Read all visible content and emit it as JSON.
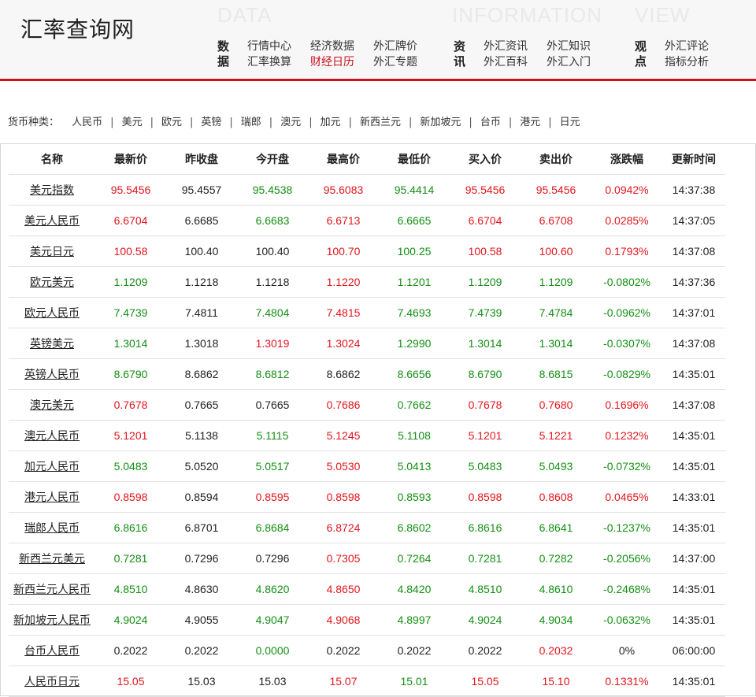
{
  "header": {
    "logo": "汇率查询网",
    "bg_words": [
      "DATA",
      "INFORMATION",
      "VIEW"
    ],
    "groups": [
      {
        "head": [
          "数",
          "据"
        ],
        "links": [
          "行情中心",
          "经济数据",
          "外汇牌价",
          "汇率换算",
          "财经日历",
          "外汇专题"
        ]
      },
      {
        "head": [
          "资",
          "讯"
        ],
        "links": [
          "外汇资讯",
          "外汇知识",
          "外汇百科",
          "外汇入门"
        ]
      },
      {
        "head": [
          "观",
          "点"
        ],
        "links": [
          "外汇评论",
          "指标分析"
        ]
      }
    ],
    "active_link": "财经日历"
  },
  "currency_bar": {
    "label": "货币种类：",
    "items": [
      "人民币",
      "美元",
      "欧元",
      "英镑",
      "瑞郎",
      "澳元",
      "加元",
      "新西兰元",
      "新加坡元",
      "台币",
      "港元",
      "日元"
    ],
    "separator": "|"
  },
  "colors": {
    "up": "#e1161d",
    "down": "#138f13",
    "flat": "#222222",
    "accent": "#c8121e"
  },
  "table": {
    "columns": [
      "名称",
      "最新价",
      "昨收盘",
      "今开盘",
      "最高价",
      "最低价",
      "买入价",
      "卖出价",
      "涨跌幅",
      "更新时间"
    ],
    "rows": [
      {
        "cells": [
          "美元指数",
          "95.5456",
          "95.4557",
          "95.4538",
          "95.6083",
          "95.4414",
          "95.5456",
          "95.5456",
          "0.0942%",
          "14:37:38"
        ],
        "colors": [
          "n",
          "r",
          "k",
          "g",
          "r",
          "g",
          "r",
          "r",
          "r",
          "k"
        ]
      },
      {
        "cells": [
          "美元人民币",
          "6.6704",
          "6.6685",
          "6.6683",
          "6.6713",
          "6.6665",
          "6.6704",
          "6.6708",
          "0.0285%",
          "14:37:05"
        ],
        "colors": [
          "n",
          "r",
          "k",
          "g",
          "r",
          "g",
          "r",
          "r",
          "r",
          "k"
        ]
      },
      {
        "cells": [
          "美元日元",
          "100.58",
          "100.40",
          "100.40",
          "100.70",
          "100.25",
          "100.58",
          "100.60",
          "0.1793%",
          "14:37:08"
        ],
        "colors": [
          "n",
          "r",
          "k",
          "k",
          "r",
          "g",
          "r",
          "r",
          "r",
          "k"
        ]
      },
      {
        "cells": [
          "欧元美元",
          "1.1209",
          "1.1218",
          "1.1218",
          "1.1220",
          "1.1201",
          "1.1209",
          "1.1209",
          "-0.0802%",
          "14:37:36"
        ],
        "colors": [
          "n",
          "g",
          "k",
          "k",
          "r",
          "g",
          "g",
          "g",
          "g",
          "k"
        ]
      },
      {
        "cells": [
          "欧元人民币",
          "7.4739",
          "7.4811",
          "7.4804",
          "7.4815",
          "7.4693",
          "7.4739",
          "7.4784",
          "-0.0962%",
          "14:37:01"
        ],
        "colors": [
          "n",
          "g",
          "k",
          "g",
          "r",
          "g",
          "g",
          "g",
          "g",
          "k"
        ]
      },
      {
        "cells": [
          "英镑美元",
          "1.3014",
          "1.3018",
          "1.3019",
          "1.3024",
          "1.2990",
          "1.3014",
          "1.3014",
          "-0.0307%",
          "14:37:08"
        ],
        "colors": [
          "n",
          "g",
          "k",
          "r",
          "r",
          "g",
          "g",
          "g",
          "g",
          "k"
        ]
      },
      {
        "cells": [
          "英镑人民币",
          "8.6790",
          "8.6862",
          "8.6812",
          "8.6862",
          "8.6656",
          "8.6790",
          "8.6815",
          "-0.0829%",
          "14:35:01"
        ],
        "colors": [
          "n",
          "g",
          "k",
          "g",
          "k",
          "g",
          "g",
          "g",
          "g",
          "k"
        ]
      },
      {
        "cells": [
          "澳元美元",
          "0.7678",
          "0.7665",
          "0.7665",
          "0.7686",
          "0.7662",
          "0.7678",
          "0.7680",
          "0.1696%",
          "14:37:08"
        ],
        "colors": [
          "n",
          "r",
          "k",
          "k",
          "r",
          "g",
          "r",
          "r",
          "r",
          "k"
        ]
      },
      {
        "cells": [
          "澳元人民币",
          "5.1201",
          "5.1138",
          "5.1115",
          "5.1245",
          "5.1108",
          "5.1201",
          "5.1221",
          "0.1232%",
          "14:35:01"
        ],
        "colors": [
          "n",
          "r",
          "k",
          "g",
          "r",
          "g",
          "r",
          "r",
          "r",
          "k"
        ]
      },
      {
        "cells": [
          "加元人民币",
          "5.0483",
          "5.0520",
          "5.0517",
          "5.0530",
          "5.0413",
          "5.0483",
          "5.0493",
          "-0.0732%",
          "14:35:01"
        ],
        "colors": [
          "n",
          "g",
          "k",
          "g",
          "r",
          "g",
          "g",
          "g",
          "g",
          "k"
        ]
      },
      {
        "cells": [
          "港元人民币",
          "0.8598",
          "0.8594",
          "0.8595",
          "0.8598",
          "0.8593",
          "0.8598",
          "0.8608",
          "0.0465%",
          "14:33:01"
        ],
        "colors": [
          "n",
          "r",
          "k",
          "r",
          "r",
          "g",
          "r",
          "r",
          "r",
          "k"
        ]
      },
      {
        "cells": [
          "瑞郎人民币",
          "6.8616",
          "6.8701",
          "6.8684",
          "6.8724",
          "6.8602",
          "6.8616",
          "6.8641",
          "-0.1237%",
          "14:35:01"
        ],
        "colors": [
          "n",
          "g",
          "k",
          "g",
          "r",
          "g",
          "g",
          "g",
          "g",
          "k"
        ]
      },
      {
        "cells": [
          "新西兰元美元",
          "0.7281",
          "0.7296",
          "0.7296",
          "0.7305",
          "0.7264",
          "0.7281",
          "0.7282",
          "-0.2056%",
          "14:37:00"
        ],
        "colors": [
          "n",
          "g",
          "k",
          "k",
          "r",
          "g",
          "g",
          "g",
          "g",
          "k"
        ]
      },
      {
        "cells": [
          "新西兰元人民币",
          "4.8510",
          "4.8630",
          "4.8620",
          "4.8650",
          "4.8420",
          "4.8510",
          "4.8610",
          "-0.2468%",
          "14:35:01"
        ],
        "colors": [
          "n",
          "g",
          "k",
          "g",
          "r",
          "g",
          "g",
          "g",
          "g",
          "k"
        ]
      },
      {
        "cells": [
          "新加坡元人民币",
          "4.9024",
          "4.9055",
          "4.9047",
          "4.9068",
          "4.8997",
          "4.9024",
          "4.9034",
          "-0.0632%",
          "14:35:01"
        ],
        "colors": [
          "n",
          "g",
          "k",
          "g",
          "r",
          "g",
          "g",
          "g",
          "g",
          "k"
        ]
      },
      {
        "cells": [
          "台币人民币",
          "0.2022",
          "0.2022",
          "0.0000",
          "0.2022",
          "0.2022",
          "0.2022",
          "0.2032",
          "0%",
          "06:00:00"
        ],
        "colors": [
          "n",
          "k",
          "k",
          "g",
          "k",
          "k",
          "k",
          "r",
          "k",
          "k"
        ]
      },
      {
        "cells": [
          "人民币日元",
          "15.05",
          "15.03",
          "15.03",
          "15.07",
          "15.01",
          "15.05",
          "15.10",
          "0.1331%",
          "14:35:01"
        ],
        "colors": [
          "n",
          "r",
          "k",
          "k",
          "r",
          "g",
          "r",
          "r",
          "r",
          "k"
        ]
      }
    ]
  }
}
